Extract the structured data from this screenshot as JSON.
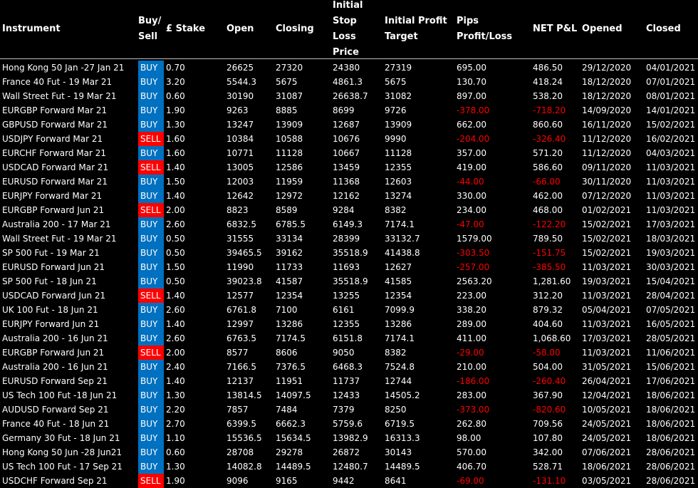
{
  "columns": [
    {
      "key": "instrument",
      "label": "Instrument"
    },
    {
      "key": "side",
      "label": "Buy/\nSell"
    },
    {
      "key": "stake",
      "label": "£ Stake"
    },
    {
      "key": "open",
      "label": "Open"
    },
    {
      "key": "closing",
      "label": "Closing"
    },
    {
      "key": "stop",
      "label": "Initial Stop\nLoss Price"
    },
    {
      "key": "target",
      "label": "Initial Profit\nTarget"
    },
    {
      "key": "pips",
      "label": "Pips Profit/Loss"
    },
    {
      "key": "pnl",
      "label": "NET P&L"
    },
    {
      "key": "opened",
      "label": "Opened"
    },
    {
      "key": "closed",
      "label": "Closed"
    }
  ],
  "colors": {
    "buy": "#0070c0",
    "sell": "#ff0000",
    "loss": "#ff0000",
    "background": "#000000",
    "text": "#ffffff"
  },
  "rows": [
    [
      "Hong Kong 50 Jan -27 Jan 21",
      "BUY",
      "0.70",
      "26625",
      "27320",
      "24380",
      "27319",
      "695.00",
      "486.50",
      "29/12/2020",
      "04/01/2021"
    ],
    [
      "France 40 Fut - 19 Mar 21",
      "BUY",
      "3.20",
      "5544.3",
      "5675",
      "4861.3",
      "5675",
      "130.70",
      "418.24",
      "18/12/2020",
      "07/01/2021"
    ],
    [
      "Wall Street Fut - 19 Mar 21",
      "BUY",
      "0.60",
      "30190",
      "31087",
      "26638.7",
      "31082",
      "897.00",
      "538.20",
      "18/12/2020",
      "08/01/2021"
    ],
    [
      "EURGBP Forward Mar 21",
      "BUY",
      "1.90",
      "9263",
      "8885",
      "8699",
      "9726",
      "-378.00",
      "-718.20",
      "14/09/2020",
      "14/01/2021"
    ],
    [
      "GBPUSD Forward Mar 21",
      "BUY",
      "1.30",
      "13247",
      "13909",
      "12687",
      "13909",
      "662.00",
      "860.60",
      "16/11/2020",
      "15/02/2021"
    ],
    [
      "USDJPY Forward Mar 21",
      "SELL",
      "1.60",
      "10384",
      "10588",
      "10676",
      "9990",
      "-204.00",
      "-326.40",
      "11/12/2020",
      "16/02/2021"
    ],
    [
      "EURCHF Forward Mar 21",
      "BUY",
      "1.60",
      "10771",
      "11128",
      "10667",
      "11128",
      "357.00",
      "571.20",
      "11/12/2020",
      "04/03/2021"
    ],
    [
      "USDCAD Forward Mar 21",
      "SELL",
      "1.40",
      "13005",
      "12586",
      "13459",
      "12355",
      "419.00",
      "586.60",
      "09/11/2020",
      "11/03/2021"
    ],
    [
      "EURUSD Forward Mar 21",
      "BUY",
      "1.50",
      "12003",
      "11959",
      "11368",
      "12603",
      "-44.00",
      "-66.00",
      "30/11/2020",
      "11/03/2021"
    ],
    [
      "EURJPY Forward Mar 21",
      "BUY",
      "1.40",
      "12642",
      "12972",
      "12162",
      "13274",
      "330.00",
      "462.00",
      "07/12/2020",
      "11/03/2021"
    ],
    [
      "EURGBP Forward Jun 21",
      "SELL",
      "2.00",
      "8823",
      "8589",
      "9284",
      "8382",
      "234.00",
      "468.00",
      "01/02/2021",
      "11/03/2021"
    ],
    [
      "Australia 200 - 17 Mar 21",
      "BUY",
      "2.60",
      "6832.5",
      "6785.5",
      "6149.3",
      "7174.1",
      "-47.00",
      "-122.20",
      "15/02/2021",
      "17/03/2021"
    ],
    [
      "Wall Street Fut - 19 Mar 21",
      "BUY",
      "0.50",
      "31555",
      "33134",
      "28399",
      "33132.7",
      "1579.00",
      "789.50",
      "15/02/2021",
      "18/03/2021"
    ],
    [
      "SP 500 Fut - 19 Mar 21",
      "BUY",
      "0.50",
      "39465.5",
      "39162",
      "35518.9",
      "41438.8",
      "-303.50",
      "-151.75",
      "15/02/2021",
      "19/03/2021"
    ],
    [
      "EURUSD Forward Jun 21",
      "BUY",
      "1.50",
      "11990",
      "11733",
      "11693",
      "12627",
      "-257.00",
      "-385.50",
      "11/03/2021",
      "30/03/2021"
    ],
    [
      "SP 500 Fut - 18 Jun 21",
      "BUY",
      "0.50",
      "39023.8",
      "41587",
      "35518.9",
      "41585",
      "2563.20",
      "1,281.60",
      "19/03/2021",
      "15/04/2021"
    ],
    [
      "USDCAD Forward Jun 21",
      "SELL",
      "1.40",
      "12577",
      "12354",
      "13255",
      "12354",
      "223.00",
      "312.20",
      "11/03/2021",
      "28/04/2021"
    ],
    [
      "UK 100 Fut - 18 Jun 21",
      "BUY",
      "2.60",
      "6761.8",
      "7100",
      "6161",
      "7099.9",
      "338.20",
      "879.32",
      "05/04/2021",
      "07/05/2021"
    ],
    [
      "EURJPY Forward Jun 21",
      "BUY",
      "1.40",
      "12997",
      "13286",
      "12355",
      "13286",
      "289.00",
      "404.60",
      "11/03/2021",
      "16/05/2021"
    ],
    [
      "Australia 200 - 16 Jun 21",
      "BUY",
      "2.60",
      "6763.5",
      "7174.5",
      "6151.8",
      "7174.1",
      "411.00",
      "1,068.60",
      "17/03/2021",
      "28/05/2021"
    ],
    [
      "EURGBP Forward Jun 21",
      "SELL",
      "2.00",
      "8577",
      "8606",
      "9050",
      "8382",
      "-29.00",
      "-58.00",
      "11/03/2021",
      "11/06/2021"
    ],
    [
      "Australia 200 - 16 Jun 21",
      "BUY",
      "2.40",
      "7166.5",
      "7376.5",
      "6468.3",
      "7524.8",
      "210.00",
      "504.00",
      "31/05/2021",
      "15/06/2021"
    ],
    [
      "EURUSD Forward Sep 21",
      "BUY",
      "1.40",
      "12137",
      "11951",
      "11737",
      "12744",
      "-186.00",
      "-260.40",
      "26/04/2021",
      "17/06/2021"
    ],
    [
      "US Tech 100 Fut -18 Jun 21",
      "BUY",
      "1.30",
      "13814.5",
      "14097.5",
      "12433",
      "14505.2",
      "283.00",
      "367.90",
      "12/04/2021",
      "18/06/2021"
    ],
    [
      "AUDUSD Forward Sep 21",
      "BUY",
      "2.20",
      "7857",
      "7484",
      "7379",
      "8250",
      "-373.00",
      "-820.60",
      "10/05/2021",
      "18/06/2021"
    ],
    [
      "France 40 Fut - 18 Jun 21",
      "BUY",
      "2.70",
      "6399.5",
      "6662.3",
      "5759.6",
      "6719.5",
      "262.80",
      "709.56",
      "24/05/2021",
      "18/06/2021"
    ],
    [
      "Germany 30 Fut - 18 Jun 21",
      "BUY",
      "1.10",
      "15536.5",
      "15634.5",
      "13982.9",
      "16313.3",
      "98.00",
      "107.80",
      "24/05/2021",
      "18/06/2021"
    ],
    [
      "Hong Kong 50 Jun -28 Jun21",
      "BUY",
      "0.60",
      "28708",
      "29278",
      "26872",
      "30143",
      "570.00",
      "342.00",
      "07/06/2021",
      "28/06/2021"
    ],
    [
      "US Tech 100 Fut - 17 Sep 21",
      "BUY",
      "1.30",
      "14082.8",
      "14489.5",
      "12480.7",
      "14489.5",
      "406.70",
      "528.71",
      "18/06/2021",
      "28/06/2021"
    ],
    [
      "USDCHF Forward Sep 21",
      "SELL",
      "1.90",
      "9096",
      "9165",
      "9442",
      "8641",
      "-69.00",
      "-131.10",
      "03/05/2021",
      "28/06/2021"
    ]
  ]
}
